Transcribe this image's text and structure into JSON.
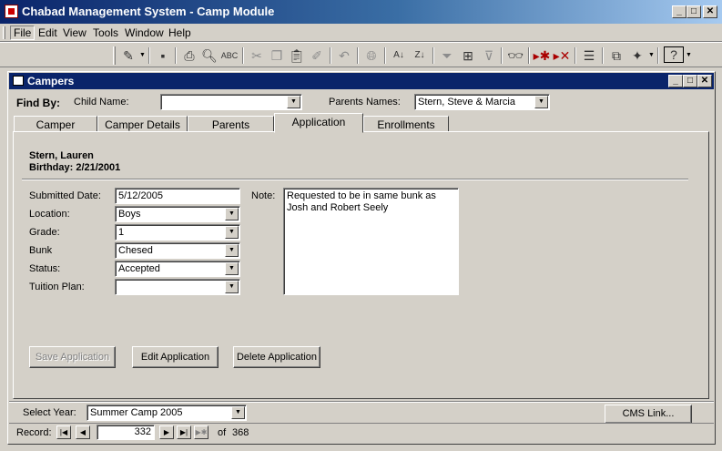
{
  "window": {
    "title": "Chabad Management System - Camp Module"
  },
  "menu": {
    "items": [
      "File",
      "Edit",
      "View",
      "Tools",
      "Window",
      "Help"
    ]
  },
  "form": {
    "title": "Campers"
  },
  "find_by": {
    "label": "Find By:",
    "child_name_label": "Child Name:",
    "child_name_value": "",
    "parents_names_label": "Parents Names:",
    "parents_names_value": "Stern, Steve & Marcia"
  },
  "tabs": [
    {
      "label": "Camper",
      "active": false
    },
    {
      "label": "Camper Details",
      "active": false
    },
    {
      "label": "Parents",
      "active": false
    },
    {
      "label": "Application",
      "active": true
    },
    {
      "label": "Enrollments",
      "active": false
    }
  ],
  "camper": {
    "name": "Stern, Lauren",
    "birthday": "Birthday: 2/21/2001"
  },
  "application": {
    "submitted_date_label": "Submitted Date:",
    "submitted_date": "5/12/2005",
    "location_label": "Location:",
    "location": "Boys",
    "grade_label": "Grade:",
    "grade": "1",
    "bunk_label": "Bunk",
    "bunk": "Chesed",
    "status_label": "Status:",
    "status": "Accepted",
    "tuition_plan_label": "Tuition Plan:",
    "tuition_plan": "",
    "note_label": "Note:",
    "note": "Requested to be in same bunk as Josh and Robert Seely"
  },
  "buttons": {
    "save": "Save Application",
    "edit": "Edit Application",
    "delete": "Delete Application",
    "cms_link": "CMS Link..."
  },
  "footer": {
    "select_year_label": "Select Year:",
    "select_year_value": "Summer Camp 2005"
  },
  "record_nav": {
    "label": "Record:",
    "current": "332",
    "of_label": "of",
    "total": "368"
  },
  "colors": {
    "titlebar": "#0a246a",
    "face": "#d4d0c8"
  }
}
